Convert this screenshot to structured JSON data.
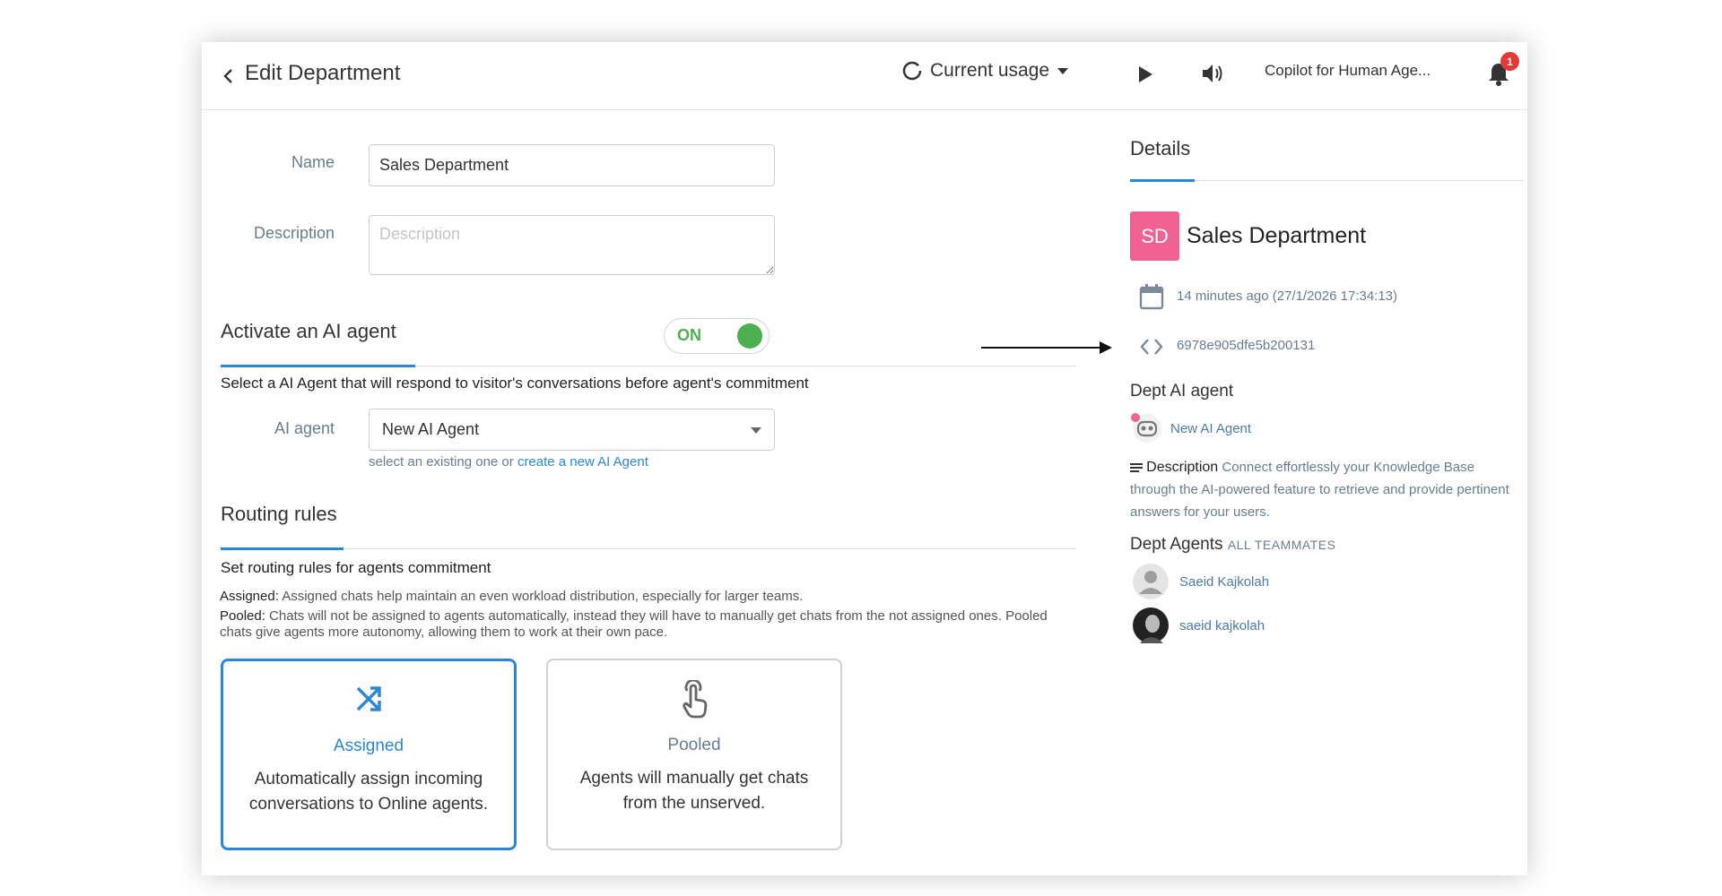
{
  "header": {
    "title": "Edit Department",
    "usage_label": "Current usage",
    "copilot_label": "Copilot for Human Age...",
    "notification_count": "1"
  },
  "form": {
    "name_label": "Name",
    "name_value": "Sales Department",
    "description_label": "Description",
    "description_placeholder": "Description",
    "ai_section_title": "Activate an AI agent",
    "toggle_label": "ON",
    "ai_instruction": "Select a AI Agent that will respond to visitor's conversations before agent's commitment",
    "ai_agent_label": "AI agent",
    "ai_agent_value": "New AI Agent",
    "ai_hint_prefix": "select an existing one or",
    "ai_hint_link": "create a new AI Agent",
    "routing_title": "Routing rules",
    "routing_instruction": "Set routing rules for agents commitment",
    "assigned_key": "Assigned:",
    "assigned_text": "Assigned chats help maintain an even workload distribution, especially for larger teams.",
    "pooled_key": "Pooled:",
    "pooled_text": "Chats will not be assigned to agents automatically, instead they will have to manually get chats from the not assigned ones. Pooled chats give agents more autonomy, allowing them to work at their own pace.",
    "cards": [
      {
        "title": "Assigned",
        "desc": "Automatically assign incoming conversations to Online agents.",
        "icon": "shuffle-icon",
        "selected": true
      },
      {
        "title": "Pooled",
        "desc": "Agents will manually get chats from the unserved.",
        "icon": "touch-hand-icon",
        "selected": false
      }
    ]
  },
  "details": {
    "title": "Details",
    "avatar_initials": "SD",
    "dept_name": "Sales Department",
    "created": "14 minutes ago (27/1/2026 17:34:13)",
    "id": "6978e905dfe5b200131",
    "ai_agent_title": "Dept AI agent",
    "ai_agent_name": "New AI Agent",
    "description_key": "Description",
    "description_text": "Connect effortlessly your Knowledge Base through the AI-powered feature to retrieve and provide pertinent answers for your users.",
    "agents_title": "Dept Agents",
    "agents_sub": "ALL TEAMMATES",
    "agents": [
      "Saeid Kajkolah",
      "saeid kajkolah"
    ]
  },
  "colors": {
    "accent": "#2b86d6",
    "toggle_on": "#4caf50",
    "avatar": "#f06292",
    "badge": "#e53935"
  }
}
